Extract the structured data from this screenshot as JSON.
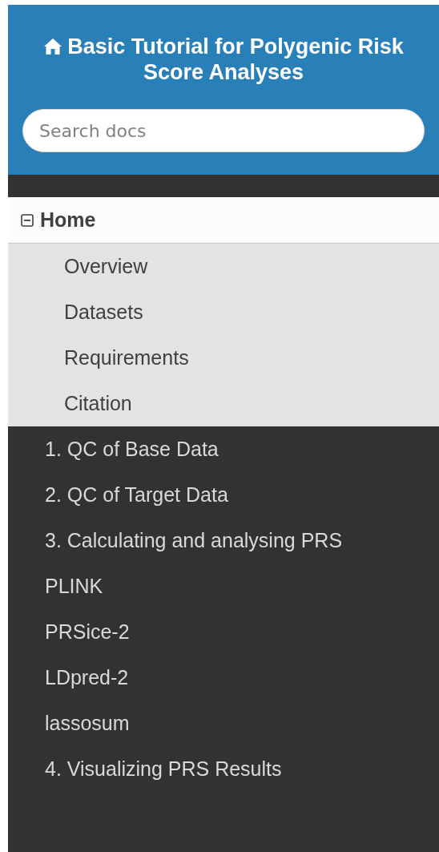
{
  "header": {
    "title": "Basic Tutorial for Polygenic Risk Score Analyses"
  },
  "search": {
    "placeholder": "Search docs"
  },
  "nav": [
    {
      "label": "Home",
      "selected": true,
      "expanded": true,
      "children": [
        {
          "label": "Overview"
        },
        {
          "label": "Datasets"
        },
        {
          "label": "Requirements"
        },
        {
          "label": "Citation"
        }
      ]
    },
    {
      "label": "1. QC of Base Data",
      "selected": false
    },
    {
      "label": "2. QC of Target Data",
      "selected": false
    },
    {
      "label": "3. Calculating and analysing PRS",
      "selected": false
    },
    {
      "label": "PLINK",
      "selected": false
    },
    {
      "label": "PRSice-2",
      "selected": false
    },
    {
      "label": "LDpred-2",
      "selected": false
    },
    {
      "label": "lassosum",
      "selected": false
    },
    {
      "label": "4. Visualizing PRS Results",
      "selected": false
    }
  ]
}
